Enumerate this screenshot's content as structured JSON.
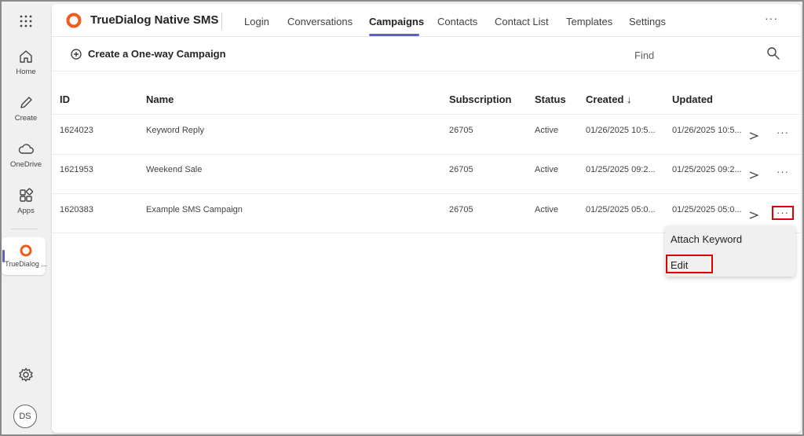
{
  "rail": {
    "items": [
      {
        "label": "Home",
        "icon": "home-icon"
      },
      {
        "label": "Create",
        "icon": "pen-icon"
      },
      {
        "label": "OneDrive",
        "icon": "cloud-icon"
      },
      {
        "label": "Apps",
        "icon": "apps-icon"
      },
      {
        "label": "TrueDialog ...",
        "icon": "truedialog-logo-icon"
      }
    ],
    "settings_icon": "gear-icon",
    "avatar": "DS"
  },
  "app": {
    "title": "TrueDialog Native SMS",
    "brand_color": "#f05a1a"
  },
  "tabs": [
    {
      "label": "Login"
    },
    {
      "label": "Conversations"
    },
    {
      "label": "Campaigns",
      "active": true
    },
    {
      "label": "Contacts"
    },
    {
      "label": "Contact List"
    },
    {
      "label": "Templates"
    },
    {
      "label": "Settings"
    }
  ],
  "topbar": {
    "more": "···"
  },
  "commands": {
    "create_label": "Create a One-way Campaign",
    "find_placeholder": "Find"
  },
  "table": {
    "headers": {
      "id": "ID",
      "name": "Name",
      "subscription": "Subscription",
      "status": "Status",
      "created": "Created ↓",
      "updated": "Updated"
    },
    "rows": [
      {
        "id": "1624023",
        "name": "Keyword Reply",
        "subscription": "26705",
        "status": "Active",
        "created": "01/26/2025 10:5...",
        "updated": "01/26/2025 10:5...",
        "more": "···"
      },
      {
        "id": "1621953",
        "name": "Weekend Sale",
        "subscription": "26705",
        "status": "Active",
        "created": "01/25/2025 09:2...",
        "updated": "01/25/2025 09:2...",
        "more": "···"
      },
      {
        "id": "1620383",
        "name": "Example SMS Campaign",
        "subscription": "26705",
        "status": "Active",
        "created": "01/25/2025 05:0...",
        "updated": "01/25/2025 05:0...",
        "more": "···"
      }
    ]
  },
  "context_menu": {
    "items": [
      {
        "label": "Attach Keyword"
      },
      {
        "label": "Edit"
      }
    ]
  },
  "colors": {
    "accent": "#5b5fc7",
    "highlight": "#e00000"
  }
}
